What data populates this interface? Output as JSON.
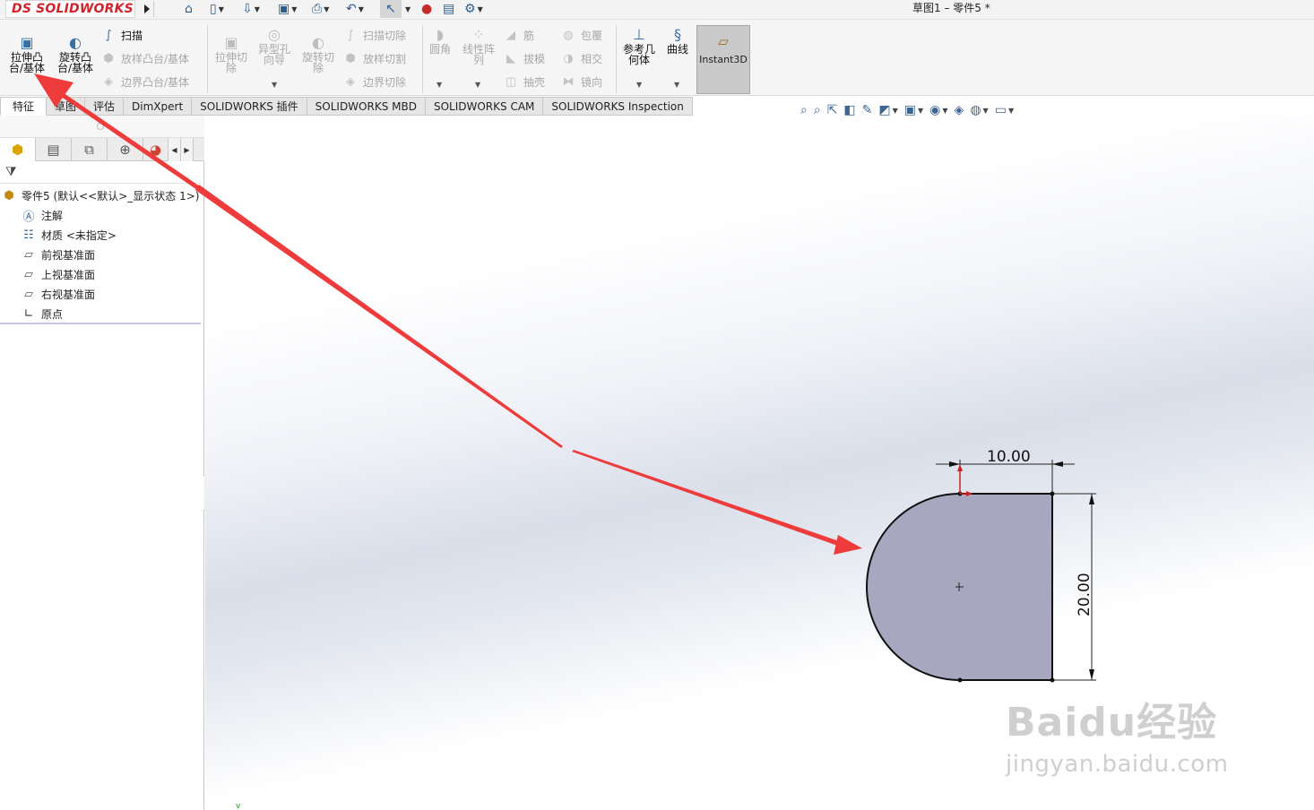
{
  "app": {
    "logo_text": "SOLIDWORKS",
    "logo_mark": "DS",
    "document_title": "草图1 – 零件5 *"
  },
  "command_manager": {
    "extrude_boss": "拉伸凸台/基体",
    "revolve_boss": "旋转凸台/基体",
    "sweep": "扫描",
    "loft_boss": "放样凸台/基体",
    "boundary_boss": "边界凸台/基体",
    "extrude_cut": "拉伸切除",
    "hole_wizard": "异型孔向导",
    "revolve_cut": "旋转切除",
    "swept_cut": "扫描切除",
    "lofted_cut": "放样切割",
    "boundary_cut": "边界切除",
    "fillet": "圆角",
    "linear_pattern": "线性阵列",
    "rib": "筋",
    "draft": "拔模",
    "shell": "抽壳",
    "wrap": "包覆",
    "intersect": "相交",
    "mirror": "镜向",
    "ref_geometry": "参考几何体",
    "curves": "曲线",
    "instant3d": "Instant3D"
  },
  "tabs": [
    "特征",
    "草图",
    "评估",
    "DimXpert",
    "SOLIDWORKS 插件",
    "SOLIDWORKS MBD",
    "SOLIDWORKS CAM",
    "SOLIDWORKS Inspection"
  ],
  "feature_tree": {
    "root": "零件5 (默认<<默认>_显示状态 1>)",
    "items": [
      {
        "label": "注解",
        "icon": "annotation-icon"
      },
      {
        "label": "材质 <未指定>",
        "icon": "material-icon"
      },
      {
        "label": "前视基准面",
        "icon": "plane-icon"
      },
      {
        "label": "上视基准面",
        "icon": "plane-icon"
      },
      {
        "label": "右视基准面",
        "icon": "plane-icon"
      },
      {
        "label": "原点",
        "icon": "origin-icon"
      }
    ]
  },
  "sketch": {
    "width_dimension": "10.00",
    "height_dimension": "20.00",
    "profile_fill": "#a7a8c0",
    "arrow_color": "#ee3b3b"
  },
  "watermark": {
    "brand": "Baidu经验",
    "url": "jingyan.baidu.com"
  }
}
